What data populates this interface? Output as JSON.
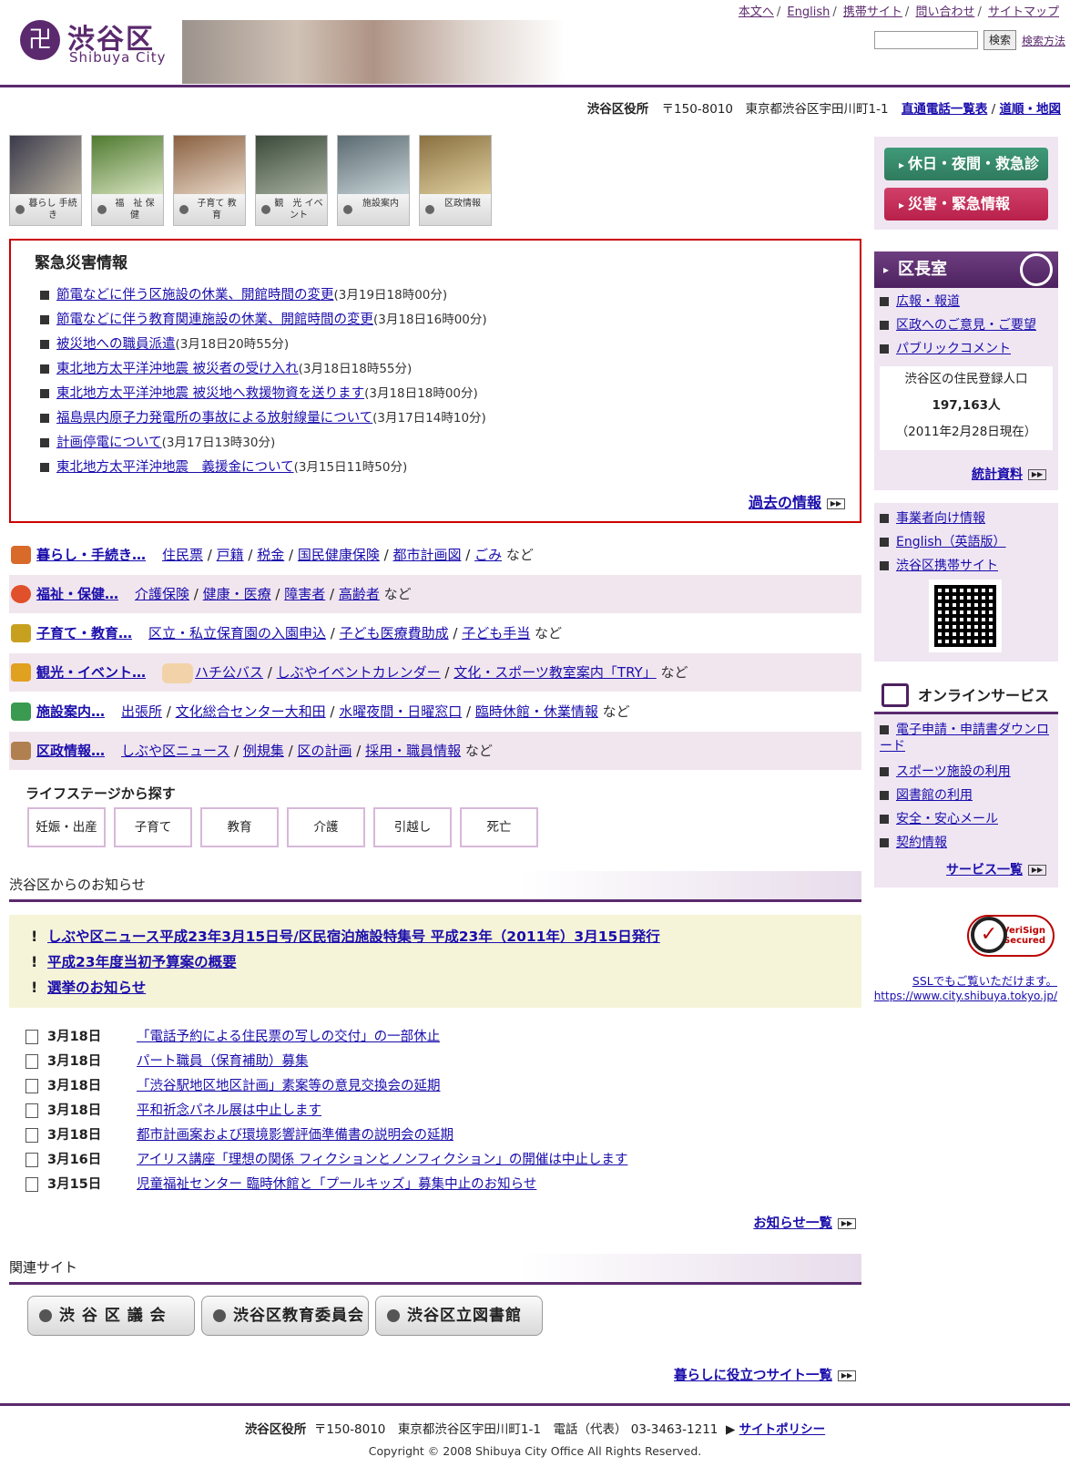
{
  "header": {
    "logo_mark": "卍",
    "logo_ja": "渋谷区",
    "logo_en": "Shibuya City",
    "top_links": [
      "本文へ",
      "English",
      "携帯サイト",
      "問い合わせ",
      "サイトマップ"
    ],
    "search_placeholder": "",
    "search_button": "検索",
    "search_help": "検索方法"
  },
  "address_bar": {
    "office": "渋谷区役所",
    "address": "〒150-8010　東京都渋谷区宇田川町1-1",
    "link_phone": "直通電話一覧表",
    "link_map": "道順・地図"
  },
  "nav_icons": [
    {
      "label": "暮らし 手続き"
    },
    {
      "label": "福　祉 保　健"
    },
    {
      "label": "子育て 教　育"
    },
    {
      "label": "観　光 イベント"
    },
    {
      "label": "施設案内"
    },
    {
      "label": "区政情報"
    }
  ],
  "emergency": {
    "title": "緊急災害情報",
    "items": [
      {
        "text": "節電などに伴う区施設の休業、開館時間の変更",
        "date": "(3月19日18時00分)"
      },
      {
        "text": "節電などに伴う教育関連施設の休業、開館時間の変更",
        "date": "(3月18日16時00分)"
      },
      {
        "text": "被災地への職員派遣",
        "date": "(3月18日20時55分)"
      },
      {
        "text": "東北地方太平洋沖地震 被災者の受け入れ",
        "date": "(3月18日18時55分)"
      },
      {
        "text": "東北地方太平洋沖地震 被災地へ救援物資を送ります",
        "date": "(3月18日18時00分)"
      },
      {
        "text": "福島県内原子力発電所の事故による放射線量について",
        "date": "(3月17日14時10分)"
      },
      {
        "text": "計画停電について",
        "date": "(3月17日13時30分)"
      },
      {
        "text": "東北地方太平洋沖地震　義援金について",
        "date": "(3月15日11時50分)"
      }
    ],
    "past_link": "過去の情報"
  },
  "categories": [
    {
      "name": "暮らし・手続き…",
      "links": [
        "住民票",
        "戸籍",
        "税金",
        "国民健康保険",
        "都市計画図",
        "ごみ"
      ],
      "tail": "など",
      "icon_color": "#d86a2a"
    },
    {
      "name": "福祉・保健…",
      "links": [
        "介護保険",
        "健康・医療",
        "障害者",
        "高齢者"
      ],
      "tail": "など",
      "icon_color": "#e0502a"
    },
    {
      "name": "子育て・教育…",
      "links": [
        "区立・私立保育園の入園申込",
        "子ども医療費助成",
        "子ども手当"
      ],
      "tail": "など",
      "icon_color": "#c8a020"
    },
    {
      "name": "観光・イベント…",
      "links": [
        "ハチ公バス",
        "しぶやイベントカレンダー",
        "文化・スポーツ教室案内「TRY」"
      ],
      "tail": "など",
      "icon_color": "#e0a020"
    },
    {
      "name": "施設案内…",
      "links": [
        "出張所",
        "文化総合センター大和田",
        "水曜夜間・日曜窓口",
        "臨時休館・休業情報"
      ],
      "tail": "など",
      "icon_color": "#3a9a50"
    },
    {
      "name": "区政情報…",
      "links": [
        "しぶや区ニュース",
        "例規集",
        "区の計画",
        "採用・職員情報"
      ],
      "tail": "など",
      "icon_color": "#b08050"
    }
  ],
  "life_stage": {
    "heading": "ライフステージから探す",
    "buttons": [
      "妊娠・出産",
      "子育て",
      "教育",
      "介護",
      "引越し",
      "死亡"
    ]
  },
  "notices_section": {
    "heading": "渋谷区からのお知らせ",
    "highlight": [
      "しぶや区ニュース平成23年3月15日号/区民宿泊施設特集号 平成23年（2011年）3月15日発行",
      "平成23年度当初予算案の概要",
      "選挙のお知らせ"
    ],
    "news": [
      {
        "date": "3月18日",
        "text": "「電話予約による住民票の写しの交付」の一部休止"
      },
      {
        "date": "3月18日",
        "text": "パート職員（保育補助）募集"
      },
      {
        "date": "3月18日",
        "text": "「渋谷駅地区地区計画」素案等の意見交換会の延期"
      },
      {
        "date": "3月18日",
        "text": "平和祈念パネル展は中止します"
      },
      {
        "date": "3月18日",
        "text": "都市計画案および環境影響評価準備書の説明会の延期"
      },
      {
        "date": "3月16日",
        "text": "アイリス講座「理想の関係 フィクションとノンフィクション」の開催は中止します"
      },
      {
        "date": "3月15日",
        "text": "児童福祉センター 臨時休館と「プールキッズ」募集中止のお知らせ"
      }
    ],
    "all_link": "お知らせ一覧"
  },
  "related": {
    "heading": "関連サイト",
    "buttons": [
      "渋 谷 区 議 会",
      "渋谷区教育委員会",
      "渋谷区立図書館"
    ],
    "all_link": "暮らしに役立つサイト一覧"
  },
  "footer": {
    "office": "渋谷区役所",
    "address": "〒150-8010　東京都渋谷区宇田川町1-1　電話（代表） 03-3463-1211",
    "policy": "サイトポリシー",
    "copyright": "Copyright © 2008 Shibuya City Office All Rights Reserved."
  },
  "sidebar": {
    "btn_holiday": "休日・夜間・救急診療",
    "btn_disaster": "災害・緊急情報",
    "mayor_head": "区長室",
    "mayor_links": [
      "広報・報道",
      "区政へのご意見・ご要望",
      "パブリックコメント"
    ],
    "population": {
      "label": "渋谷区の住民登録人口",
      "value": "197,163人",
      "asof": "（2011年2月28日現在）"
    },
    "stats_link": "統計資料",
    "links2": [
      "事業者向け情報",
      "English（英語版）",
      "渋谷区携帯サイト"
    ],
    "online_head": "オンラインサービス",
    "online_links": [
      "電子申請・申請書ダウンロード",
      "スポーツ施設の利用",
      "図書館の利用",
      "安全・安心メール",
      "契約情報"
    ],
    "service_all": "サービス一覧",
    "verisign": "VeriSign Secured",
    "ssl_text": "SSLでもご覧いただけます。",
    "ssl_url": "https://www.city.shibuya.tokyo.jp/"
  },
  "colors": {
    "brand": "#5b2a6e",
    "alert": "#cc0000",
    "btn_green": "#2f7a5e",
    "btn_red": "#b8204a"
  }
}
